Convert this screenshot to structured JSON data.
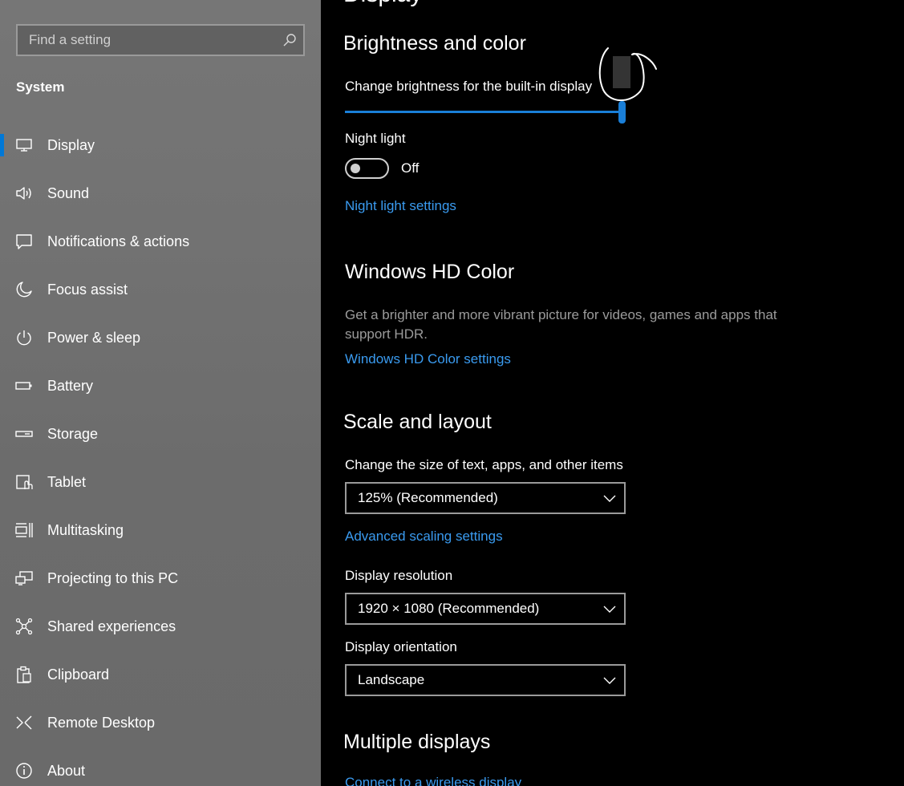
{
  "search": {
    "placeholder": "Find a setting"
  },
  "sidebar": {
    "section_title": "System",
    "items": [
      {
        "label": "Display",
        "icon": "monitor-icon",
        "selected": true
      },
      {
        "label": "Sound",
        "icon": "speaker-icon"
      },
      {
        "label": "Notifications & actions",
        "icon": "notifications-icon"
      },
      {
        "label": "Focus assist",
        "icon": "moon-icon"
      },
      {
        "label": "Power & sleep",
        "icon": "power-icon"
      },
      {
        "label": "Battery",
        "icon": "battery-icon"
      },
      {
        "label": "Storage",
        "icon": "storage-icon"
      },
      {
        "label": "Tablet",
        "icon": "tablet-icon"
      },
      {
        "label": "Multitasking",
        "icon": "multitasking-icon"
      },
      {
        "label": "Projecting to this PC",
        "icon": "projecting-icon"
      },
      {
        "label": "Shared experiences",
        "icon": "shared-icon"
      },
      {
        "label": "Clipboard",
        "icon": "clipboard-icon"
      },
      {
        "label": "Remote Desktop",
        "icon": "remote-desktop-icon"
      },
      {
        "label": "About",
        "icon": "info-icon"
      }
    ]
  },
  "main": {
    "page_title": "Display",
    "brightness": {
      "heading": "Brightness and color",
      "slider_label": "Change brightness for the built-in display",
      "value_percent": 100
    },
    "night_light": {
      "label": "Night light",
      "state": "Off",
      "settings_link": "Night light settings"
    },
    "hd_color": {
      "heading": "Windows HD Color",
      "description": "Get a brighter and more vibrant picture for videos, games and apps that support HDR.",
      "settings_link": "Windows HD Color settings"
    },
    "scale": {
      "heading": "Scale and layout",
      "size_label": "Change the size of text, apps, and other items",
      "size_value": "125% (Recommended)",
      "advanced_link": "Advanced scaling settings",
      "resolution_label": "Display resolution",
      "resolution_value": "1920 × 1080 (Recommended)",
      "orientation_label": "Display orientation",
      "orientation_value": "Landscape"
    },
    "multiple": {
      "heading": "Multiple displays",
      "connect_link": "Connect to a wireless display"
    }
  },
  "colors": {
    "accent": "#0078d7",
    "link": "#3a9bf0"
  }
}
